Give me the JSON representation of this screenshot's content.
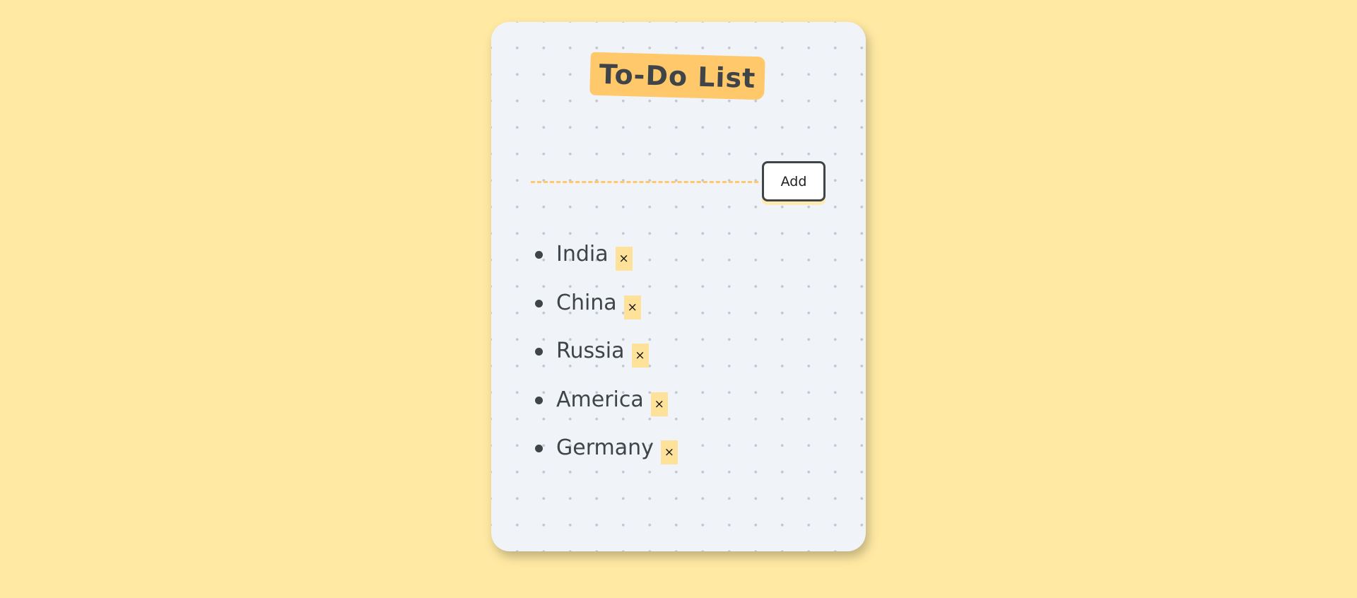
{
  "app": {
    "title": "To-Do List"
  },
  "form": {
    "input_value": "",
    "input_placeholder": "",
    "add_label": "Add"
  },
  "tasks": [
    {
      "text": "India",
      "delete_label": "×"
    },
    {
      "text": "China",
      "delete_label": "×"
    },
    {
      "text": "Russia",
      "delete_label": "×"
    },
    {
      "text": "America",
      "delete_label": "×"
    },
    {
      "text": "Germany",
      "delete_label": "×"
    }
  ],
  "colors": {
    "page_background": "#ffe9a3",
    "card_background": "#f0f4f9",
    "accent": "#ffc86a",
    "delete_background": "#ffe29a",
    "text": "#3f4448"
  },
  "icons": {
    "bullet": "bullet-dot-icon",
    "delete": "close-icon"
  }
}
